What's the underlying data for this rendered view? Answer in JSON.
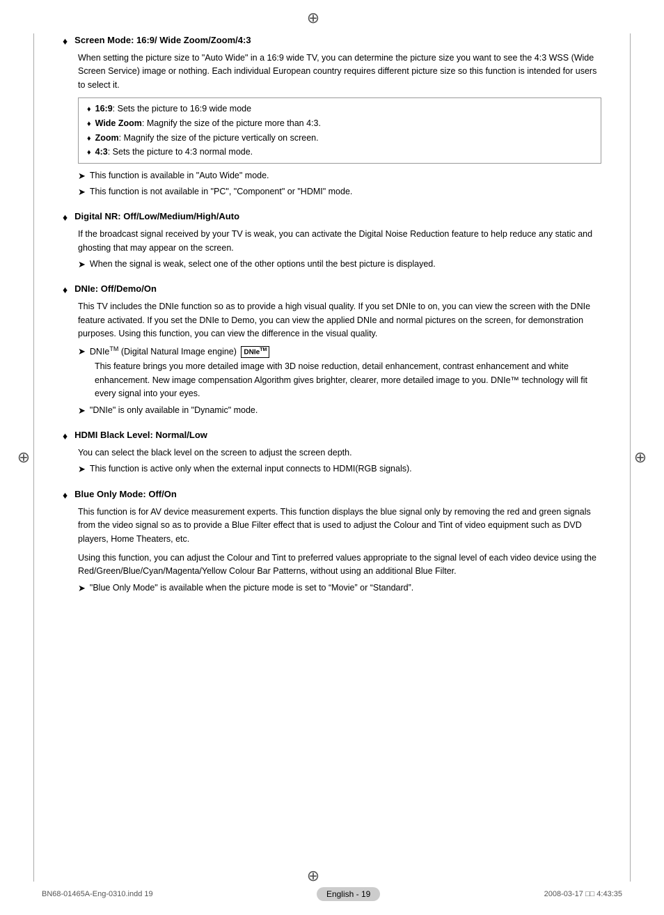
{
  "compass": {
    "symbol": "⊕"
  },
  "sections": [
    {
      "id": "screen-mode",
      "title": "Screen Mode: 16:9/ Wide Zoom/Zoom/4:3",
      "body_intro": "When setting the picture size to \"Auto Wide\" in a 16:9 wide TV, you can determine the picture size you want to see the 4:3 WSS (Wide Screen Service) image or nothing. Each individual European country requires different picture size so this function is intended for users to select it.",
      "boxed_items": [
        {
          "label": "16:9",
          "bold": true,
          "text": ": Sets the picture to 16:9 wide mode"
        },
        {
          "label": "Wide Zoom",
          "bold": true,
          "text": ": Magnify the size of the picture more than 4:3."
        },
        {
          "label": "Zoom",
          "bold": true,
          "text": ": Magnify the size of the picture vertically on screen."
        },
        {
          "label": "4:3",
          "bold": true,
          "text": ": Sets the picture to 4:3 normal mode."
        }
      ],
      "notes": [
        "This function is available in \"Auto Wide\" mode.",
        "This function is not available in \"PC\", \"Component\" or \"HDMI\" mode."
      ]
    },
    {
      "id": "digital-nr",
      "title": "Digital NR: Off/Low/Medium/High/Auto",
      "body_intro": "If the broadcast signal received by your TV is weak, you can activate the Digital Noise Reduction feature to help reduce any static and ghosting that may appear on the screen.",
      "notes": [
        "When the signal is weak, select one of the other options until the best picture is displayed."
      ]
    },
    {
      "id": "dnie",
      "title": "DNIe: Off/Demo/On",
      "body_intro": "This TV includes the DNIe function so as to provide a high visual quality. If you set DNIe to on, you can view the screen with the DNIe feature activated. If you set the DNIe to Demo, you can view the applied DNIe and normal pictures on the screen, for demonstration purposes. Using this function, you can view the difference in the visual quality.",
      "dnie_note_label": "DNIe",
      "dnie_note_sup": "TM",
      "dnie_note_text": " (Digital Natural Image engine) ",
      "dnie_badge": "DNIe™",
      "dnie_feature_text": "This feature brings you more detailed image with 3D noise reduction, detail enhancement, contrast enhancement and white enhancement. New image compensation Algorithm gives brighter, clearer, more detailed image to you. DNIe™ technology will fit every signal into your eyes.",
      "notes": [
        "\"DNIe\" is only available in \"Dynamic\" mode."
      ]
    },
    {
      "id": "hdmi-black",
      "title": "HDMI Black Level: Normal/Low",
      "body_intro": "You can select the black level on the screen to adjust the screen depth.",
      "notes": [
        "This function is active only when the external input connects to HDMI(RGB signals)."
      ]
    },
    {
      "id": "blue-only",
      "title": "Blue Only Mode: Off/On",
      "body_para1": "This function is for AV device measurement experts. This function displays the blue signal only by removing the red and green signals from the video signal so as to provide a Blue Filter effect that is used to adjust the Colour and Tint of video equipment such as DVD players, Home Theaters, etc.",
      "body_para2": "Using this function, you can adjust the Colour and Tint to preferred values appropriate to the signal level of each video device using the Red/Green/Blue/Cyan/Magenta/Yellow Colour Bar Patterns, without using an additional Blue Filter.",
      "notes": [
        "\"Blue Only Mode\" is available when the picture mode is set to “Movie” or “Standard”."
      ]
    }
  ],
  "footer": {
    "left": "BN68-01465A-Eng-0310.indd   19",
    "center": "English - 19",
    "right": "2008-03-17   □□ 4:43:35"
  }
}
